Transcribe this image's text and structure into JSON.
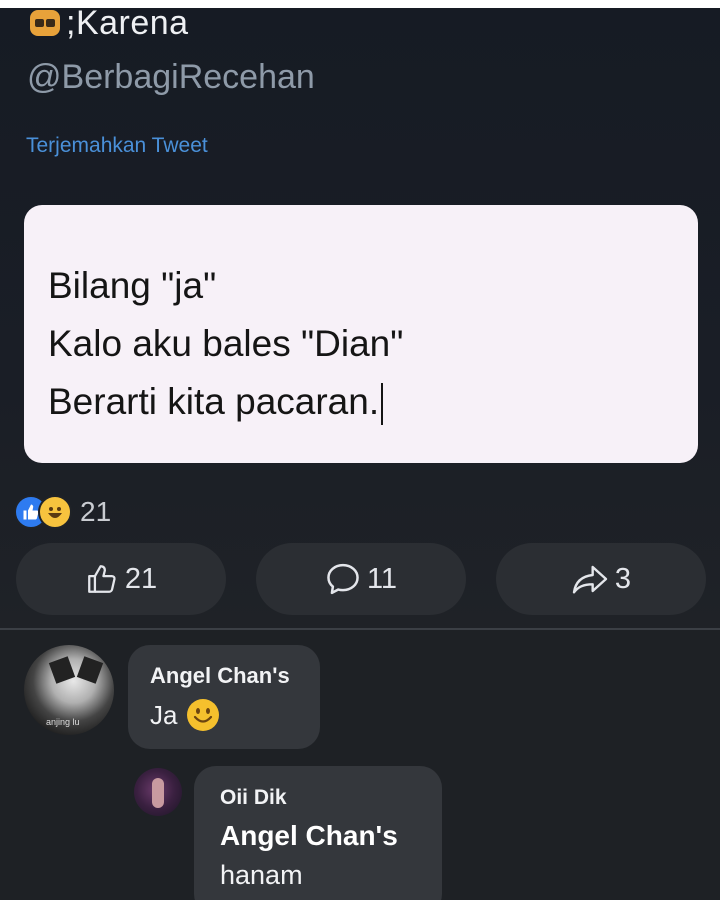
{
  "tweet": {
    "author_name": ";Karena",
    "author_emoji": "sunglasses-face-icon",
    "handle": "@BerbagiRecehan",
    "translate_label": "Terjemahkan Tweet",
    "lines": [
      "Bilang \"ja\"",
      "Kalo aku bales \"Dian\"",
      "Berarti kita pacaran."
    ]
  },
  "post": {
    "reaction_icons": [
      "like-reaction-icon",
      "haha-reaction-icon"
    ],
    "reaction_count": "21",
    "like_count": "21",
    "comment_count": "11",
    "share_count": "3"
  },
  "comments": [
    {
      "author": "Angel Chan's",
      "text": "Ja",
      "emoji": "smiling-face-icon",
      "avatar_tag": "anjing lu"
    },
    {
      "author": "Oii Dik",
      "mention": "Angel Chan's",
      "text": "hanam"
    }
  ],
  "colors": {
    "background": "#1e2125",
    "card": "#f7f1f8",
    "link_blue": "#4a90d9",
    "like_blue": "#2e7bf0",
    "bubble": "#34373c"
  }
}
